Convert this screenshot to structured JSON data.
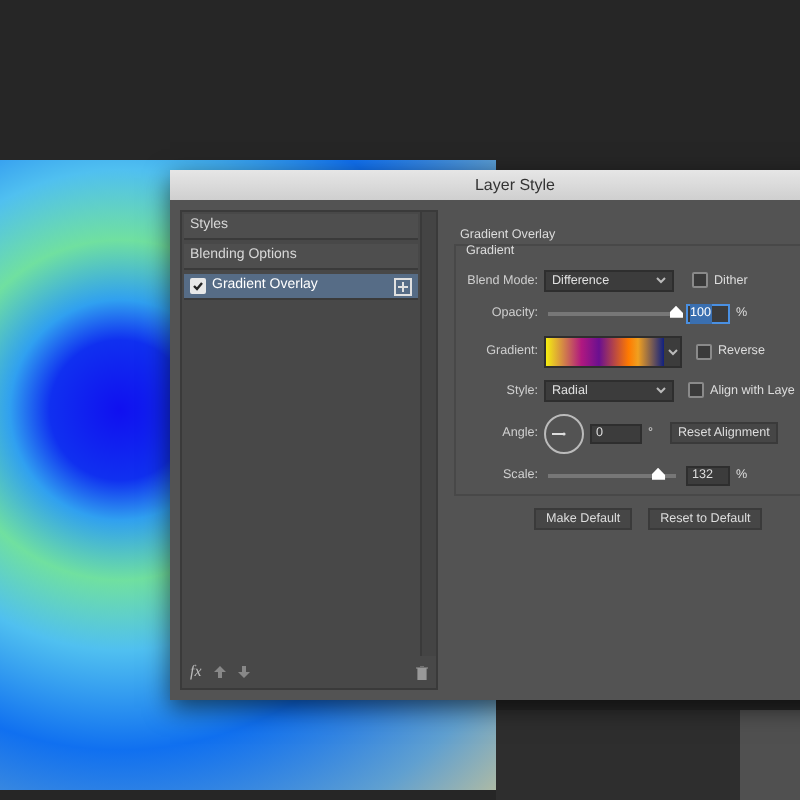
{
  "window": {
    "title": "Layer Style"
  },
  "sidebar": {
    "items": [
      {
        "label": "Styles",
        "selected": false,
        "kind": "header"
      },
      {
        "label": "Blending Options",
        "selected": false,
        "kind": "header"
      },
      {
        "label": "Gradient Overlay",
        "selected": true,
        "kind": "effect",
        "checked": true
      }
    ]
  },
  "footer": {
    "fx": "fx"
  },
  "panel": {
    "title": "Gradient Overlay",
    "group": "Gradient",
    "blend_mode": {
      "label": "Blend Mode:",
      "value": "Difference"
    },
    "dither": {
      "label": "Dither",
      "checked": false
    },
    "opacity": {
      "label": "Opacity:",
      "level": 1,
      "value": "100",
      "unit": "%"
    },
    "gradient": {
      "label": "Gradient:"
    },
    "reverse": {
      "label": "Reverse",
      "checked": false
    },
    "style": {
      "label": "Style:",
      "value": "Radial"
    },
    "align": {
      "label": "Align with Laye",
      "checked": false
    },
    "angle": {
      "label": "Angle:",
      "value": "0",
      "unit": "°",
      "button": "Reset Alignment"
    },
    "scale": {
      "label": "Scale:",
      "level": 0.86,
      "value": "132",
      "unit": "%"
    },
    "buttons": [
      "Make Default",
      "Reset to Default"
    ]
  }
}
